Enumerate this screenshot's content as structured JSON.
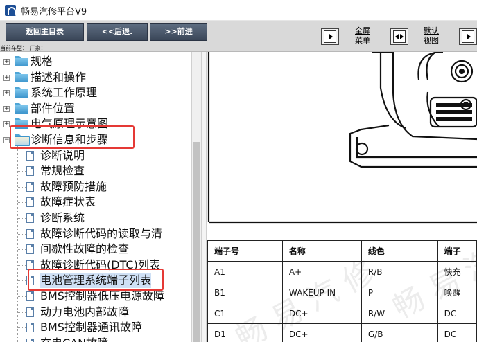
{
  "window": {
    "title": "畅易汽修平台V9",
    "icon": "app-logo-icon"
  },
  "toolbar": {
    "back_main": "返回主目录",
    "back": "<<后退.",
    "forward": ">>前进",
    "fullscreen_label": "全屏\n菜单",
    "default_view_label": "默认\n视图",
    "crumb": "当前车型：   厂家："
  },
  "tree": {
    "items": [
      {
        "label": "规格",
        "type": "folder"
      },
      {
        "label": "描述和操作",
        "type": "folder"
      },
      {
        "label": "系统工作原理",
        "type": "folder"
      },
      {
        "label": "部件位置",
        "type": "folder"
      },
      {
        "label": "电气原理示意图",
        "type": "folder"
      },
      {
        "label": "诊断信息和步骤",
        "type": "folder-open"
      },
      {
        "label": "诊断说明",
        "type": "doc"
      },
      {
        "label": "常规检查",
        "type": "doc"
      },
      {
        "label": "故障预防措施",
        "type": "doc"
      },
      {
        "label": "故障症状表",
        "type": "doc"
      },
      {
        "label": "诊断系统",
        "type": "doc"
      },
      {
        "label": "故障诊断代码的读取与清",
        "type": "doc"
      },
      {
        "label": "间歇性故障的检查",
        "type": "doc"
      },
      {
        "label": "故障诊断代码(DTC)列表",
        "type": "doc"
      },
      {
        "label": "电池管理系统端子列表",
        "type": "doc",
        "selected": true
      },
      {
        "label": "BMS控制器低压电源故障",
        "type": "doc"
      },
      {
        "label": "动力电池内部故障",
        "type": "doc"
      },
      {
        "label": "BMS控制器通讯故障",
        "type": "doc"
      },
      {
        "label": "充电CAN故障",
        "type": "doc"
      }
    ]
  },
  "terminal_table": {
    "headers": [
      "端子号",
      "名称",
      "线色",
      "端子"
    ],
    "rows": [
      [
        "A1",
        "A+",
        "R/B",
        "快充"
      ],
      [
        "B1",
        "WAKEUP IN",
        "P",
        "唤醒"
      ],
      [
        "C1",
        "DC+",
        "R/W",
        "DC"
      ],
      [
        "D1",
        "DC+",
        "G/B",
        "DC"
      ]
    ]
  },
  "colors": {
    "highlight_box": "#e53935",
    "toolbar_button": "#4a5668",
    "selected_item": "#cfe0f5"
  }
}
